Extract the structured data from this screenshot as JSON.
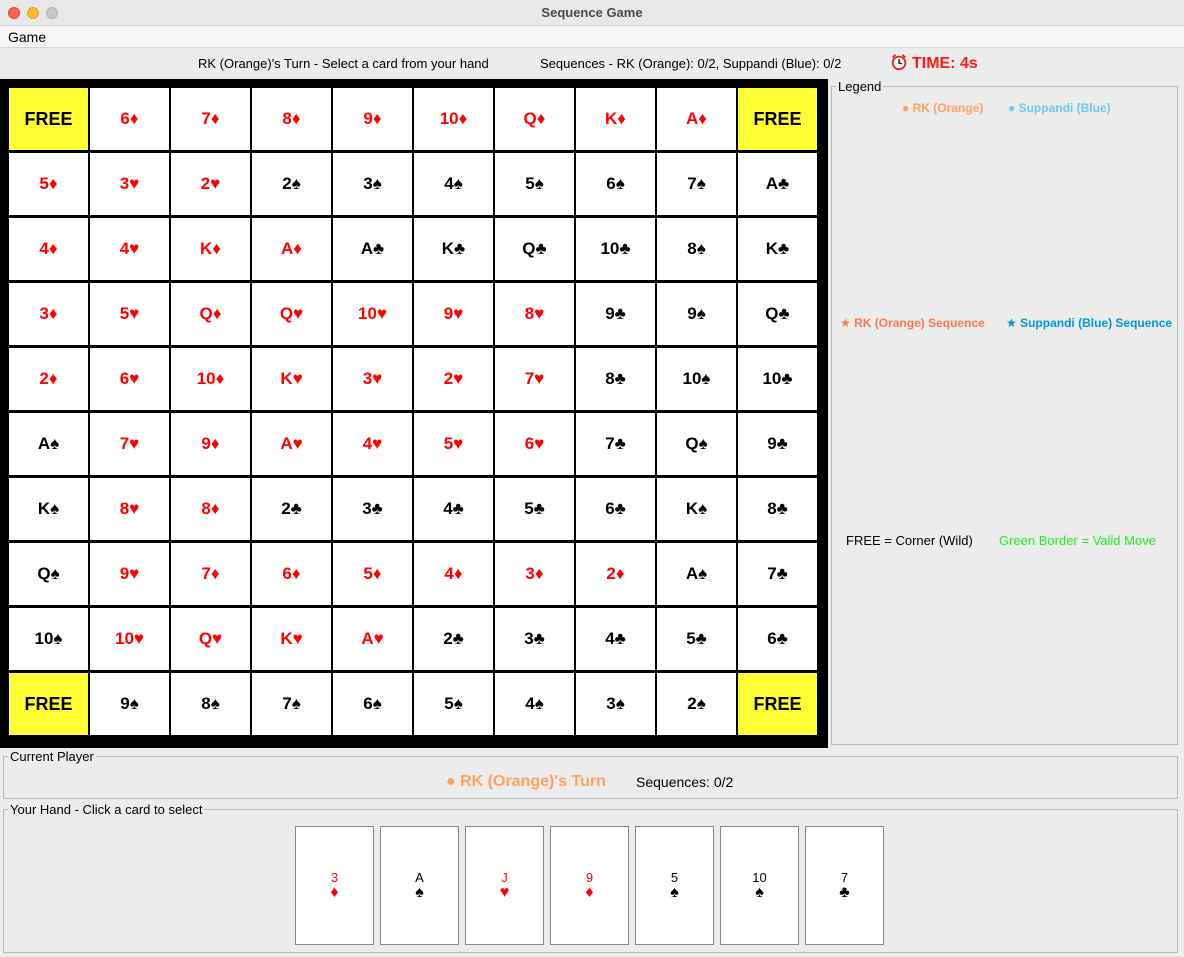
{
  "window": {
    "title": "Sequence Game"
  },
  "menu": {
    "game": "Game"
  },
  "status": {
    "turn": "RK (Orange)'s Turn - Select a card from your hand",
    "sequences": "Sequences - RK (Orange): 0/2, Suppandi (Blue): 0/2",
    "timer": "TIME: 4s"
  },
  "board": [
    [
      "FREE",
      "6♦",
      "7♦",
      "8♦",
      "9♦",
      "10♦",
      "Q♦",
      "K♦",
      "A♦",
      "FREE"
    ],
    [
      "5♦",
      "3♥",
      "2♥",
      "2♠",
      "3♠",
      "4♠",
      "5♠",
      "6♠",
      "7♠",
      "A♣"
    ],
    [
      "4♦",
      "4♥",
      "K♦",
      "A♦",
      "A♣",
      "K♣",
      "Q♣",
      "10♣",
      "8♠",
      "K♣"
    ],
    [
      "3♦",
      "5♥",
      "Q♦",
      "Q♥",
      "10♥",
      "9♥",
      "8♥",
      "9♣",
      "9♠",
      "Q♣"
    ],
    [
      "2♦",
      "6♥",
      "10♦",
      "K♥",
      "3♥",
      "2♥",
      "7♥",
      "8♣",
      "10♠",
      "10♣"
    ],
    [
      "A♠",
      "7♥",
      "9♦",
      "A♥",
      "4♥",
      "5♥",
      "6♥",
      "7♣",
      "Q♠",
      "9♣"
    ],
    [
      "K♠",
      "8♥",
      "8♦",
      "2♣",
      "3♣",
      "4♣",
      "5♣",
      "6♣",
      "K♠",
      "8♣"
    ],
    [
      "Q♠",
      "9♥",
      "7♦",
      "6♦",
      "5♦",
      "4♦",
      "3♦",
      "2♦",
      "A♠",
      "7♣"
    ],
    [
      "10♠",
      "10♥",
      "Q♥",
      "K♥",
      "A♥",
      "2♣",
      "3♣",
      "4♣",
      "5♣",
      "6♣"
    ],
    [
      "FREE",
      "9♠",
      "8♠",
      "7♠",
      "6♠",
      "5♠",
      "4♠",
      "3♠",
      "2♠",
      "FREE"
    ]
  ],
  "legend": {
    "title": "Legend",
    "rk": "● RK (Orange)",
    "suppandi": "● Suppandi (Blue)",
    "rk_sequence": "★ RK (Orange) Sequence",
    "suppandi_sequence": "★ Suppandi (Blue) Sequence",
    "free_note": "FREE = Corner (Wild)",
    "green_note": "Green Border = Valid Move"
  },
  "current_player": {
    "title": "Current Player",
    "turn": "● RK (Orange)'s Turn",
    "sequences": "Sequences: 0/2"
  },
  "hand": {
    "title": "Your Hand - Click a card to select",
    "cards": [
      {
        "rank": "3",
        "suit": "♦"
      },
      {
        "rank": "A",
        "suit": "♠"
      },
      {
        "rank": "J",
        "suit": "♥"
      },
      {
        "rank": "9",
        "suit": "♦"
      },
      {
        "rank": "5",
        "suit": "♠"
      },
      {
        "rank": "10",
        "suit": "♠"
      },
      {
        "rank": "7",
        "suit": "♣"
      }
    ]
  },
  "colors": {
    "red_suit": "#ff0000",
    "free_cell": "#ffff33",
    "orange_player": "#ffa060",
    "blue_player": "#66ccf0",
    "timer": "#ff1a1a",
    "valid_move": "#22ee22"
  }
}
